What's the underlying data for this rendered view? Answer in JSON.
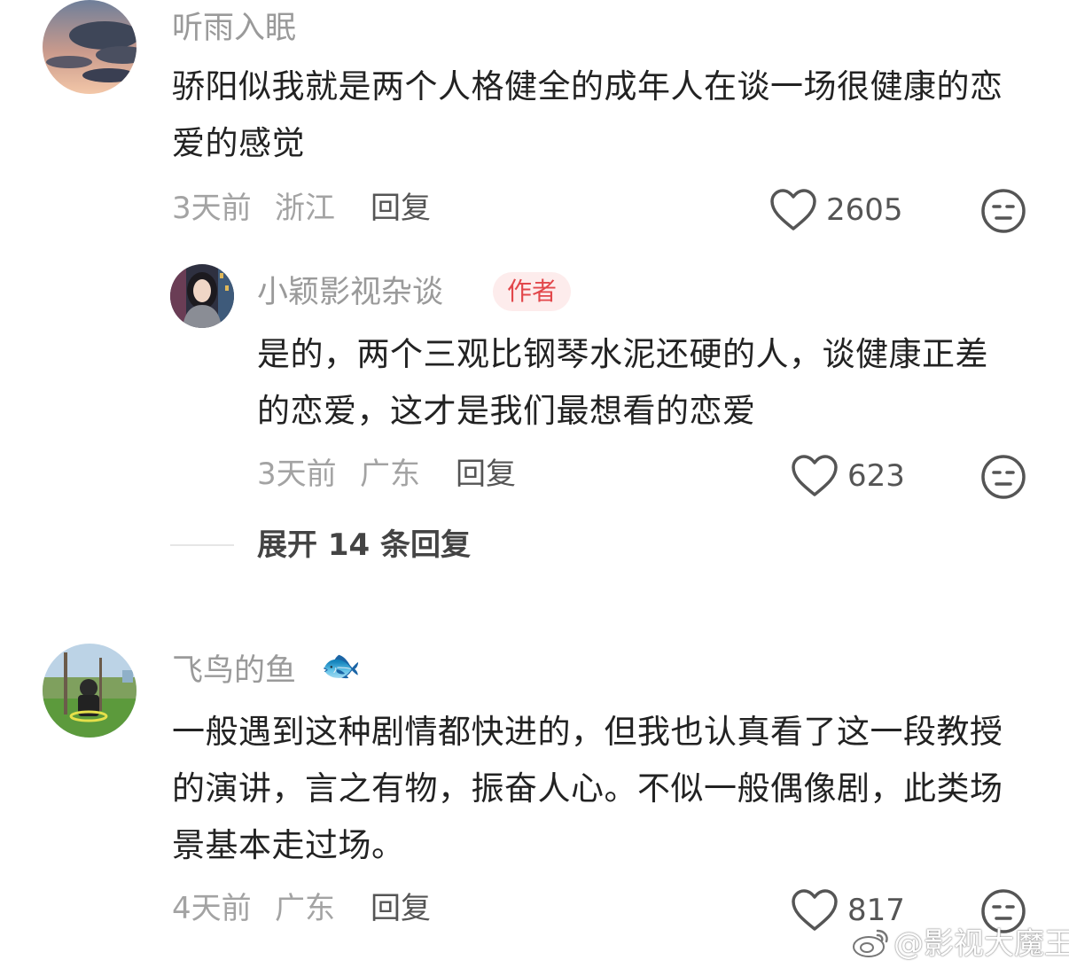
{
  "comments": [
    {
      "username": "听雨入眠",
      "text": "骄阳似我就是两个人格健全的成年人在谈一场很健康的恋爱的感觉",
      "time": "3天前",
      "location": "浙江",
      "reply_label": "回复",
      "likes": "2605"
    },
    {
      "username": "飞鸟的鱼",
      "emoji": "🐟",
      "text": "一般遇到这种剧情都快进的，但我也认真看了这一段教授的演讲，言之有物，振奋人心。不似一般偶像剧，此类场景基本走过场。",
      "time": "4天前",
      "location": "广东",
      "reply_label": "回复",
      "likes": "817"
    }
  ],
  "reply": {
    "username": "小颖影视杂谈",
    "badge": "作者",
    "text": "是的，两个三观比钢琴水泥还硬的人，谈健康正差的恋爱，这才是我们最想看的恋爱",
    "time": "3天前",
    "location": "广东",
    "reply_label": "回复",
    "likes": "623"
  },
  "expand_replies": "展开 14 条回复",
  "watermark": "@影视大魔王",
  "icons": {
    "like": "heart-outline-icon",
    "dislike": "meh-face-icon",
    "watermark": "weibo-logo-icon"
  },
  "colors": {
    "author_badge_bg": "#fdecec",
    "author_badge_text": "#e2474b"
  }
}
